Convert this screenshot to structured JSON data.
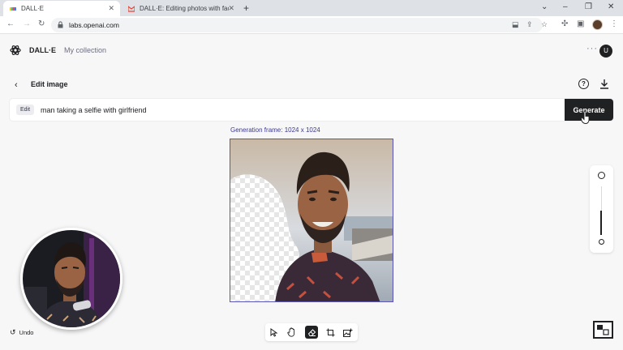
{
  "browser": {
    "tabs": [
      {
        "title": "DALL·E",
        "active": true
      },
      {
        "title": "DALL·E: Editing photos with face",
        "active": false
      }
    ],
    "url": "labs.openai.com"
  },
  "header": {
    "brand": "DALL·E",
    "nav_collection": "My collection",
    "user_initial": "U"
  },
  "editor": {
    "title": "Edit image",
    "help_label": "?",
    "edit_chip": "Edit",
    "prompt_value": "man taking a selfie with girlfriend",
    "generate_label": "Generate",
    "frame_label": "Generation frame: 1024 x 1024"
  },
  "bottom": {
    "undo_label": "Undo"
  },
  "icons": {
    "logo": "openai-logo-icon",
    "back": "chevron-left-icon",
    "download": "download-icon",
    "tools": [
      "select-arrow-icon",
      "hand-icon",
      "eraser-icon",
      "crop-frame-icon",
      "add-image-icon"
    ]
  },
  "colors": {
    "accent": "#202123",
    "frame_border": "#5a55b8",
    "frame_label": "#3c3a8f"
  }
}
